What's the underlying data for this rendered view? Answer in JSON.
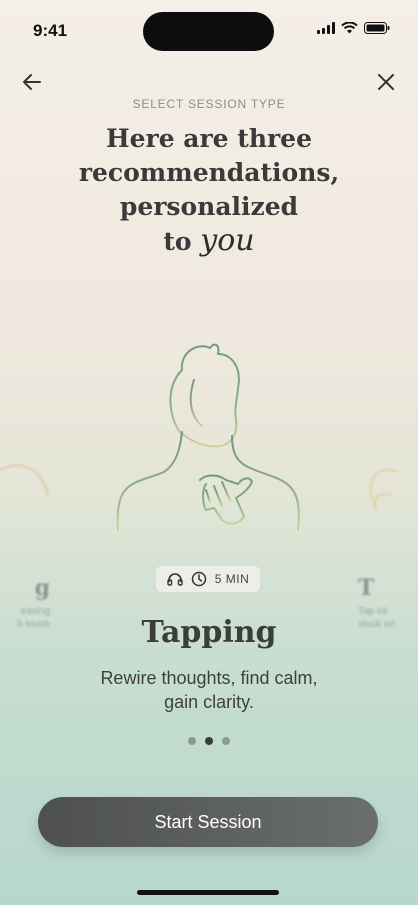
{
  "status_bar": {
    "time": "9:41"
  },
  "header": {
    "eyebrow": "SELECT SESSION TYPE",
    "headline_line1": "Here are three",
    "headline_line2": "recommendations,",
    "headline_line3": "personalized",
    "headline_to": "to",
    "headline_you": "you"
  },
  "card": {
    "duration": "5 MIN",
    "title": "Tapping",
    "description": "Rewire thoughts, find calm, gain clarity."
  },
  "side_cards": {
    "left_title": "g",
    "left_desc": "easing\nh touch",
    "right_title": "T",
    "right_desc": "Tap int\nstuck en"
  },
  "pagination": {
    "count": 3,
    "active_index": 1
  },
  "cta": {
    "label": "Start Session"
  },
  "colors": {
    "illustration": "#6f9a7e",
    "illustration_light": "#c8d49a",
    "cta": "#555857"
  }
}
